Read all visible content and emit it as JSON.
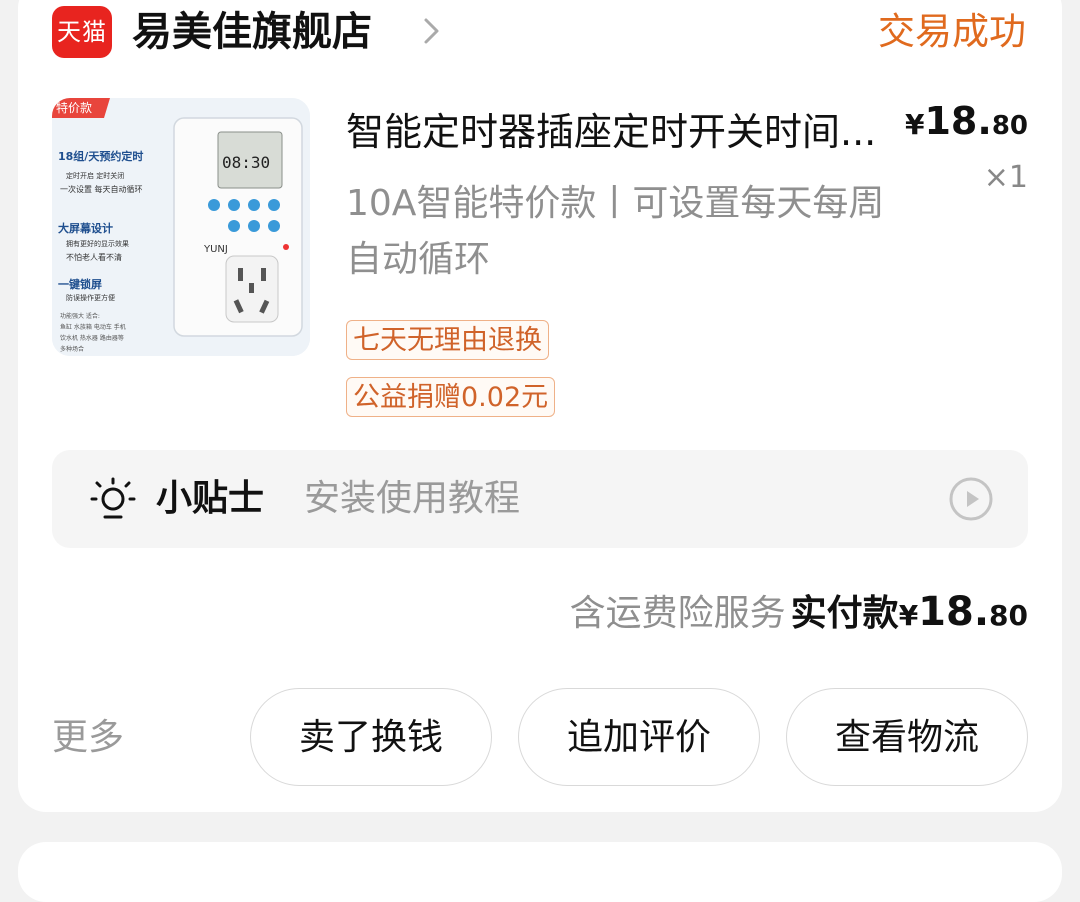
{
  "shop": {
    "logo_text": "天猫",
    "name": "易美佳旗舰店",
    "status": "交易成功"
  },
  "colors": {
    "logo_red": "#e8241f",
    "status_orange": "#e06a1e",
    "tag_orange": "#d0632a"
  },
  "product": {
    "image_badge": "特价款",
    "image_lines": [
      "18组/天预约定时",
      "定时开启 定时关闭",
      "一次设置 每天自动循环",
      "大屏幕设计",
      "拥有更好的显示效果",
      "不怕老人看不清",
      "一键锁屏",
      "防误操作更方便",
      "功能强大 适合:",
      "鱼缸 水族箱 电动车 手机",
      "饮水机 热水器 路由器等",
      "多种场合"
    ],
    "image_display": "08:30",
    "image_brand": "YUNJ",
    "title": "智能定时器插座定时开关时间...",
    "price_symbol": "¥",
    "price_int": "18.",
    "price_dec": "80",
    "quantity": "×1",
    "spec": "10A智能特价款丨可设置每天每周自动循环",
    "tags": [
      "七天无理由退换",
      "公益捐赠0.02元"
    ]
  },
  "tips": {
    "icon": "lightbulb-icon",
    "label": "小贴士",
    "text": "安装使用教程",
    "action_icon": "play-circle-icon"
  },
  "total": {
    "note": "含运费险服务",
    "label": "实付款",
    "symbol": "¥",
    "int": "18.",
    "dec": "80"
  },
  "actions": {
    "more": "更多",
    "buttons": [
      "卖了换钱",
      "追加评价",
      "查看物流"
    ]
  }
}
